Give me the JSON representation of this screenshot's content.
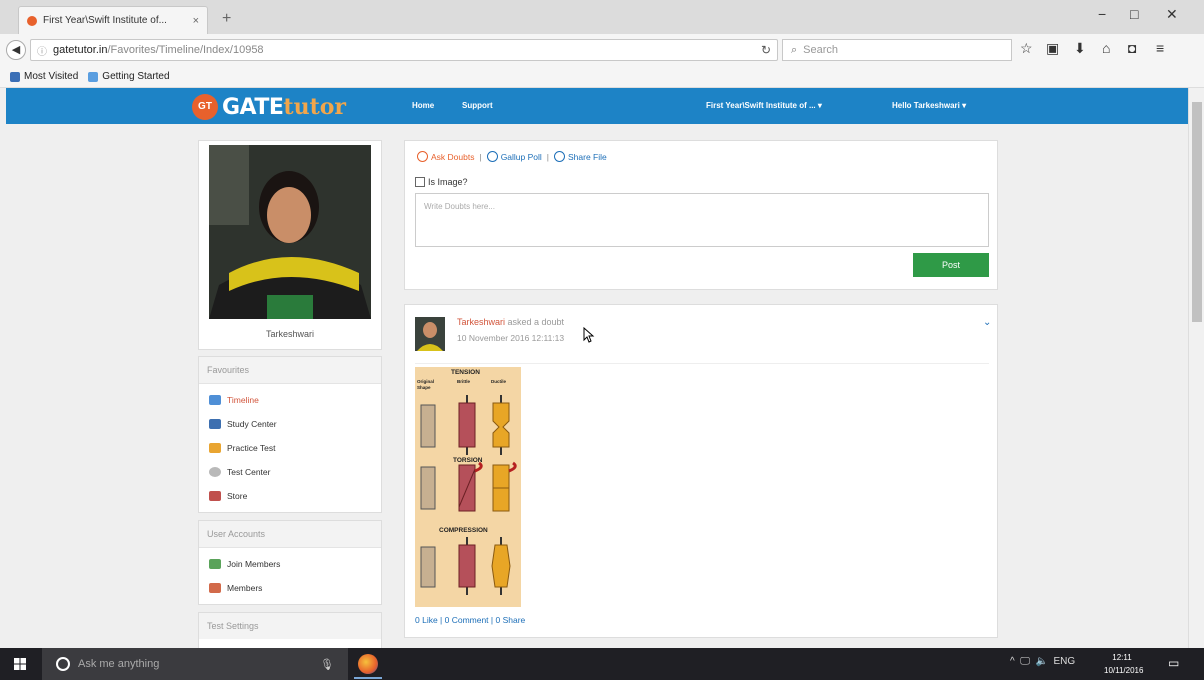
{
  "browser": {
    "tab_title": "First Year\\Swift Institute of...",
    "tab_close": "×",
    "new_tab": "+",
    "window_controls": {
      "minimize": "−",
      "maximize": "□",
      "close": "✕"
    },
    "url_host": "gatetutor.in",
    "url_path": "/Favorites/Timeline/Index/10958",
    "search_placeholder": "Search",
    "bookmarks": [
      "Most Visited",
      "Getting Started"
    ],
    "toolbar_icons": [
      "star-icon",
      "reading-list-icon",
      "download-icon",
      "home-icon",
      "pocket-icon",
      "menu-icon"
    ]
  },
  "site": {
    "logo_badge": "GT",
    "brand_a": "GATE",
    "brand_b": "tutor",
    "nav": {
      "home": "Home",
      "support": "Support",
      "institute": "First Year\\Swift Institute of ... ▾",
      "user": "Hello Tarkeshwari ▾"
    },
    "brand_color": "#1d83c6",
    "accent_color": "#e8612c"
  },
  "profile": {
    "name": "Tarkeshwari"
  },
  "menus": {
    "favourites": {
      "header": "Favourites",
      "items": [
        "Timeline",
        "Study Center",
        "Practice Test",
        "Test Center",
        "Store"
      ]
    },
    "user_accounts": {
      "header": "User Accounts",
      "items": [
        "Join Members",
        "Members"
      ]
    },
    "test_settings": {
      "header": "Test Settings"
    }
  },
  "composer": {
    "ask_doubts": "Ask Doubts",
    "gallup_poll": "Gallup Poll",
    "share_file": "Share File",
    "separator": "|",
    "is_image": "Is Image?",
    "placeholder": "Write Doubts here...",
    "post_button": "Post"
  },
  "post": {
    "user": "Tarkeshwari",
    "verb": " asked a doubt",
    "timestamp": "10 November 2016 12:11:13",
    "stats": "0 Like | 0 Comment | 0 Share",
    "attachment": {
      "title_tension": "TENSION",
      "col_original": "Original Shape",
      "col_brittle": "Brittle",
      "col_ductile": "Ductile",
      "title_torsion": "TORSION",
      "title_compression": "COMPRESSION"
    }
  },
  "taskbar": {
    "search_placeholder": "Ask me anything",
    "tray_lang": "ENG",
    "time": "12:11",
    "date": "10/11/2016"
  }
}
